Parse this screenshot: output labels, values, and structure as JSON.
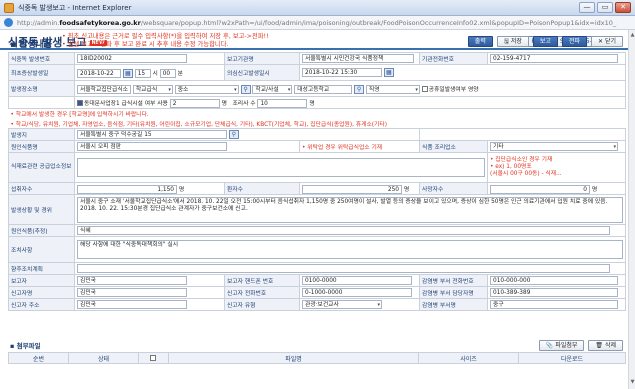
{
  "window": {
    "title": "식중독 발생보고 - Internet Explorer",
    "min": "—",
    "max": "▭",
    "close": "✕"
  },
  "address": {
    "prefix": "http://admin.",
    "host": "foodsafetykorea.go.kr",
    "path": "/websquare/popup.html?w2xPath=/ui/food/admin/ima/poisoning/outbreak/FoodPoisonOccurrenceInfo02.xml&popupID=PoisonPopup1&idx=idx10_1540255181568879"
  },
  "page": {
    "title": "식중독 발생 보고",
    "new_badge": "NEW",
    "page_id": "Page ID : S-ADM-05-05-012"
  },
  "section1": {
    "label": "▪ 발생내용",
    "warning1": "• 최초 신고내용은 근거로 필수 입력사항(*)을 입력하여 저장 후, 보고->전파!!",
    "warning2": "• 발생 보고->전파 후 보고 완료 시 추후 내용 수정 가능합니다."
  },
  "toolbar": {
    "print": "출력",
    "save": "저장",
    "report": "보고",
    "spread": "전파",
    "close": "✕ 닫기",
    "save_icon": "save-icon"
  },
  "form": {
    "report_no_label": "식중독 발생번호",
    "report_no": "18ID20002",
    "agency_label": "보고기관명",
    "agency": "서울특별시 시민건강국 식품정책",
    "agency_phone_label": "기관전화번호",
    "agency_phone": "02-159-4717",
    "first_date_label": "최초증상발생일",
    "first_date": "2018-10-22",
    "first_hour": "15",
    "first_min": "00",
    "hour_unit": "시",
    "min_unit": "분",
    "report_time_label": "의심신고발생일시",
    "report_time": "2018-10-22 15:30",
    "place_label": "발생장소명",
    "place_name": "서울학교집단급식소",
    "place_type": "학교급식",
    "place_sub": "중소",
    "place_school": "학교/사설",
    "place_dong": "대성고등학교",
    "place_mode": "직영",
    "public_check": "공휴일발생여부",
    "place_extra": "영양",
    "multi_check": "동대문사업장1 급식시설 여부 사용",
    "multi_val": "2",
    "multi_unit": "명",
    "cook_label": "조리사 수",
    "cook_val": "10",
    "cook_unit": "명",
    "note1": "• 학교에서 발생한 경우 [학교명]에 입력하시기 바랍니다.",
    "note2": "• 학교/식당, 유치원, 기업체, 자영업소, 음식점, 기타(유치원, 어린이집, 소규모기업, 단체급식, 기타), KBCT(기업체, 학교), 집단급식(종업원), 휴게소(기타)",
    "reporter_label": "발생지",
    "reporter": "서울특별시 중구 덕수궁길 15",
    "cause_food_label": "원인식품명",
    "cause_food": "서울시 오피 점판",
    "cause_note": "• 위탁업 경우 위탁급식업소 기재",
    "cook_place_label": "식품 조리업소",
    "cook_place": "기타",
    "supply_label": "식재료관련 공급업소정보",
    "right_note1": "• 집단급식소인 경우 기재",
    "right_note2": "• ex) 1, 00명포",
    "right_note3": "  (서울시 00구 00동) - 식재...",
    "patient_label": "섭취자수",
    "patient": "1,150",
    "patient_unit": "명",
    "sick_label": "환자수",
    "sick": "250",
    "sick_unit": "명",
    "death_label": "사망자수",
    "death": "0",
    "death_unit": "명",
    "summary_label": "발생상황 및 경위",
    "summary": "서울시 중구 소재 '서울학교집단급식소'에서 2018. 10. 22일 오전 15:00시부터 음식섭취자 1,150명 중 250여명이 설사, 발열 등의 증상을 보이고 있으며, 증상이 심한 50명은 인근 의료기관에서 입원 치료 중에 있음. 2018. 10. 22. 15:30분경 집단급식소 관계자가 중구보건소에 신고.",
    "cause_label": "원인식품(추정)",
    "cause": "식혜",
    "action_label": "조치사항",
    "action": "해당 사항에 대한 \"식중독대책회의\" 실시",
    "future_label": "향후조치계획",
    "future": "",
    "reporter_name_label": "보고자",
    "reporter_name": "김민국",
    "reporter_phone_label": "보고자 핸드폰 번호",
    "reporter_phone": "0100-0000",
    "dept_phone_label": "감염병 부서 전화번호",
    "dept_phone": "010-000-000",
    "caller_label": "신고자명",
    "caller": "김민국",
    "caller_phone_label": "신고자 전화번호",
    "caller_phone": "0-1000-0000",
    "dept_chief_label": "감염병 부서 담당자명",
    "dept_chief": "010-389-389",
    "caller_addr_label": "신고자 주소",
    "caller_addr": "김민국",
    "caller_type_label": "신고자 유형",
    "caller_type": "관광·보건교사",
    "dept_head_label": "감염병 부서명",
    "dept_head": "중구"
  },
  "attach": {
    "label": "▪ 첨부파일",
    "add": "파일첨부",
    "del": "삭제",
    "cols": [
      "순번",
      "상태",
      "",
      "파일명",
      "사이즈",
      "다운로드"
    ]
  }
}
